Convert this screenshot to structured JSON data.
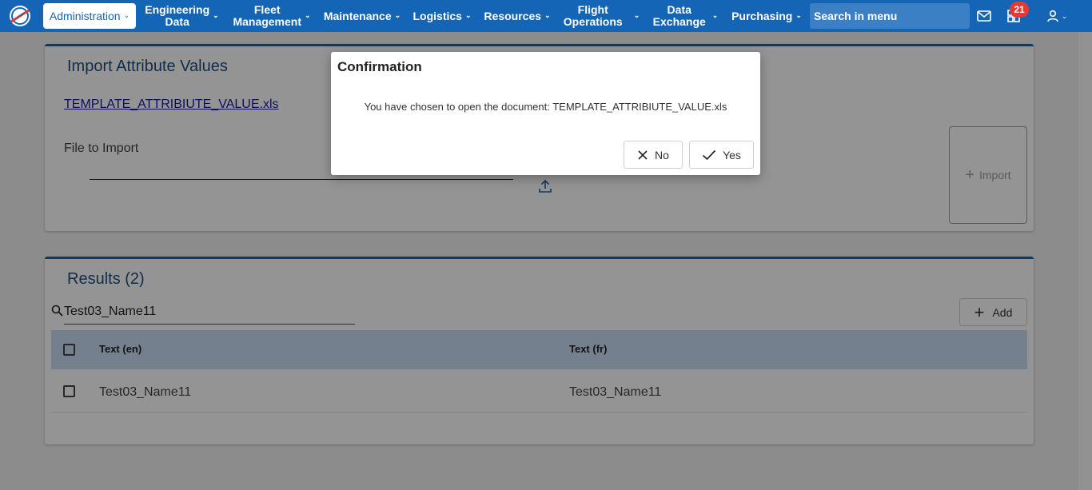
{
  "nav": {
    "items": [
      {
        "label": "Administration",
        "active": true
      },
      {
        "label": "Engineering Data",
        "line1": "Engineering",
        "line2": "Data"
      },
      {
        "label": "Fleet Management",
        "line1": "Fleet",
        "line2": "Management"
      },
      {
        "label": "Maintenance"
      },
      {
        "label": "Logistics"
      },
      {
        "label": "Resources"
      },
      {
        "label": "Flight Operations",
        "line1": "Flight",
        "line2": "Operations"
      },
      {
        "label": "Data Exchange",
        "line1": "Data",
        "line2": "Exchange"
      },
      {
        "label": "Purchasing"
      }
    ],
    "search_placeholder": "Search in menu",
    "notification_count": "21",
    "icons": [
      "mail-icon",
      "dashboard-icon",
      "user-icon"
    ]
  },
  "import_card": {
    "title": "Import Attribute Values",
    "template_link": "TEMPLATE_ATTRIBIUTE_VALUE.xls",
    "file_label": "File to Import",
    "import_button": "Import"
  },
  "results_card": {
    "title": "Results (2)",
    "search_value": "Test03_Name11",
    "add_button": "Add",
    "columns": [
      "Text (en)",
      "Text (fr)"
    ],
    "rows": [
      {
        "text_en": "Test03_Name11",
        "text_fr": "Test03_Name11"
      }
    ]
  },
  "dialog": {
    "title": "Confirmation",
    "message": "You have chosen to open the document: TEMPLATE_ATTRIBIUTE_VALUE.xls",
    "no_label": "No",
    "yes_label": "Yes"
  },
  "colors": {
    "brand": "#1565b6",
    "table_header": "#c8ddf3",
    "badge": "#e53935"
  }
}
